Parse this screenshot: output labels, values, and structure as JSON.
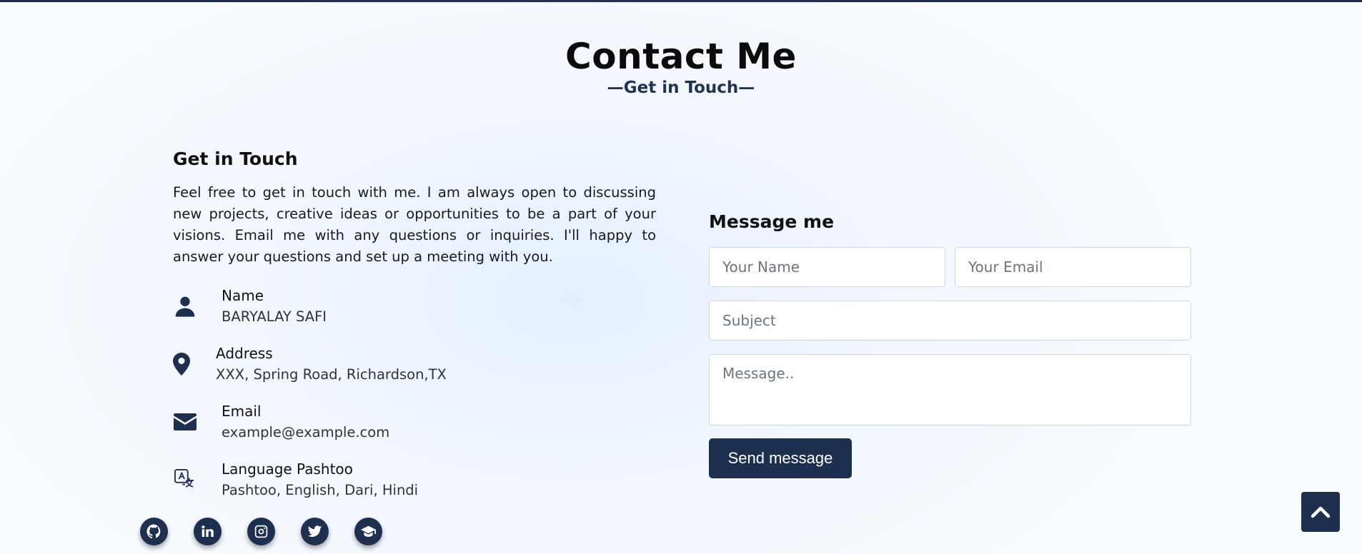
{
  "header": {
    "title": "Contact Me",
    "subtitle": "—Get in Touch—"
  },
  "left": {
    "heading": "Get in Touch",
    "intro": "Feel free to get in touch with me. I am always open to discussing new projects, creative ideas or opportunities to be a part of your visions. Email me with any questions or inquiries. I'll happy to answer your questions and set up a meeting with you.",
    "items": [
      {
        "icon": "user-icon",
        "label": "Name",
        "value": "BARYALAY SAFI"
      },
      {
        "icon": "map-marker-icon",
        "label": "Address",
        "value": "XXX, Spring Road, Richardson,TX"
      },
      {
        "icon": "envelope-icon",
        "label": "Email",
        "value": "example@example.com"
      },
      {
        "icon": "language-icon",
        "label": "Language Pashtoo",
        "value": "Pashtoo, English, Dari, Hindi"
      }
    ]
  },
  "socials": [
    {
      "icon": "github-icon"
    },
    {
      "icon": "linkedin-icon"
    },
    {
      "icon": "instagram-icon"
    },
    {
      "icon": "twitter-icon"
    },
    {
      "icon": "graduation-cap-icon"
    }
  ],
  "form": {
    "heading": "Message me",
    "name_placeholder": "Your Name",
    "email_placeholder": "Your Email",
    "subject_placeholder": "Subject",
    "message_placeholder": "Message..",
    "send_label": "Send message"
  },
  "scroll_top": {
    "icon": "chevron-up-icon"
  },
  "colors": {
    "accent": "#1e3050",
    "background": "#f1f6fe"
  }
}
